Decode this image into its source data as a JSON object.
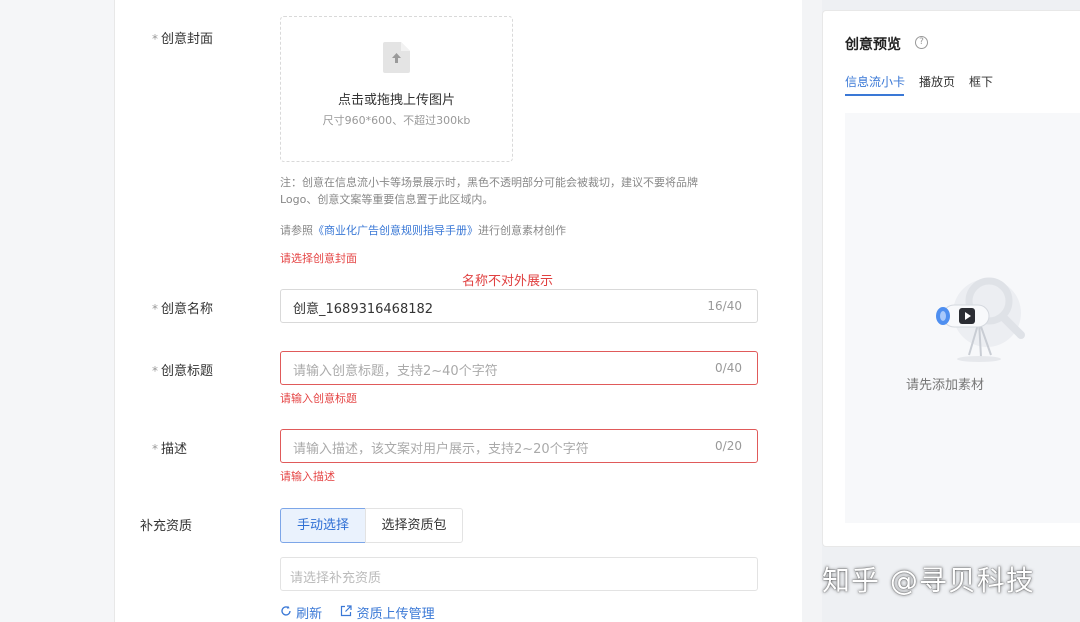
{
  "form": {
    "cover": {
      "label": "创意封面",
      "required_mark": "*",
      "upload_text": "点击或拖拽上传图片",
      "upload_hint": "尺寸960*600、不超过300kb",
      "note_line1": "注：创意在信息流小卡等场景展示时，黑色不透明部分可能会被裁切，建议不要将品牌",
      "note_line2": "Logo、创意文案等重要信息置于此区域内。",
      "ref_prefix": "请参照",
      "ref_link": "《商业化广告创意规则指导手册》",
      "ref_suffix": "进行创意素材创作",
      "error": "请选择创意封面"
    },
    "annotation": "名称不对外展示",
    "name": {
      "label": "创意名称",
      "required_mark": "*",
      "value": "创意_1689316468182",
      "count": "16/40"
    },
    "title": {
      "label": "创意标题",
      "required_mark": "*",
      "placeholder": "请输入创意标题，支持2~40个字符",
      "count": "0/40",
      "error": "请输入创意标题"
    },
    "description": {
      "label": "描述",
      "required_mark": "*",
      "placeholder": "请输入描述，该文案对用户展示，支持2~20个字符",
      "count": "0/20",
      "error": "请输入描述"
    },
    "qualification": {
      "label": "补充资质",
      "manual_button": "手动选择",
      "package_button": "选择资质包",
      "placeholder": "请选择补充资质",
      "refresh_link": "刷新",
      "upload_manage_link": "资质上传管理"
    }
  },
  "preview": {
    "title": "创意预览",
    "help_icon": "?",
    "tabs": [
      "信息流小卡",
      "播放页",
      "框下"
    ],
    "active_tab": "信息流小卡",
    "empty_text": "请先添加素材"
  },
  "watermark": "知乎 @寻贝科技",
  "colors": {
    "accent": "#3a78d6",
    "error": "#e54545",
    "border": "#d9d9d9"
  }
}
